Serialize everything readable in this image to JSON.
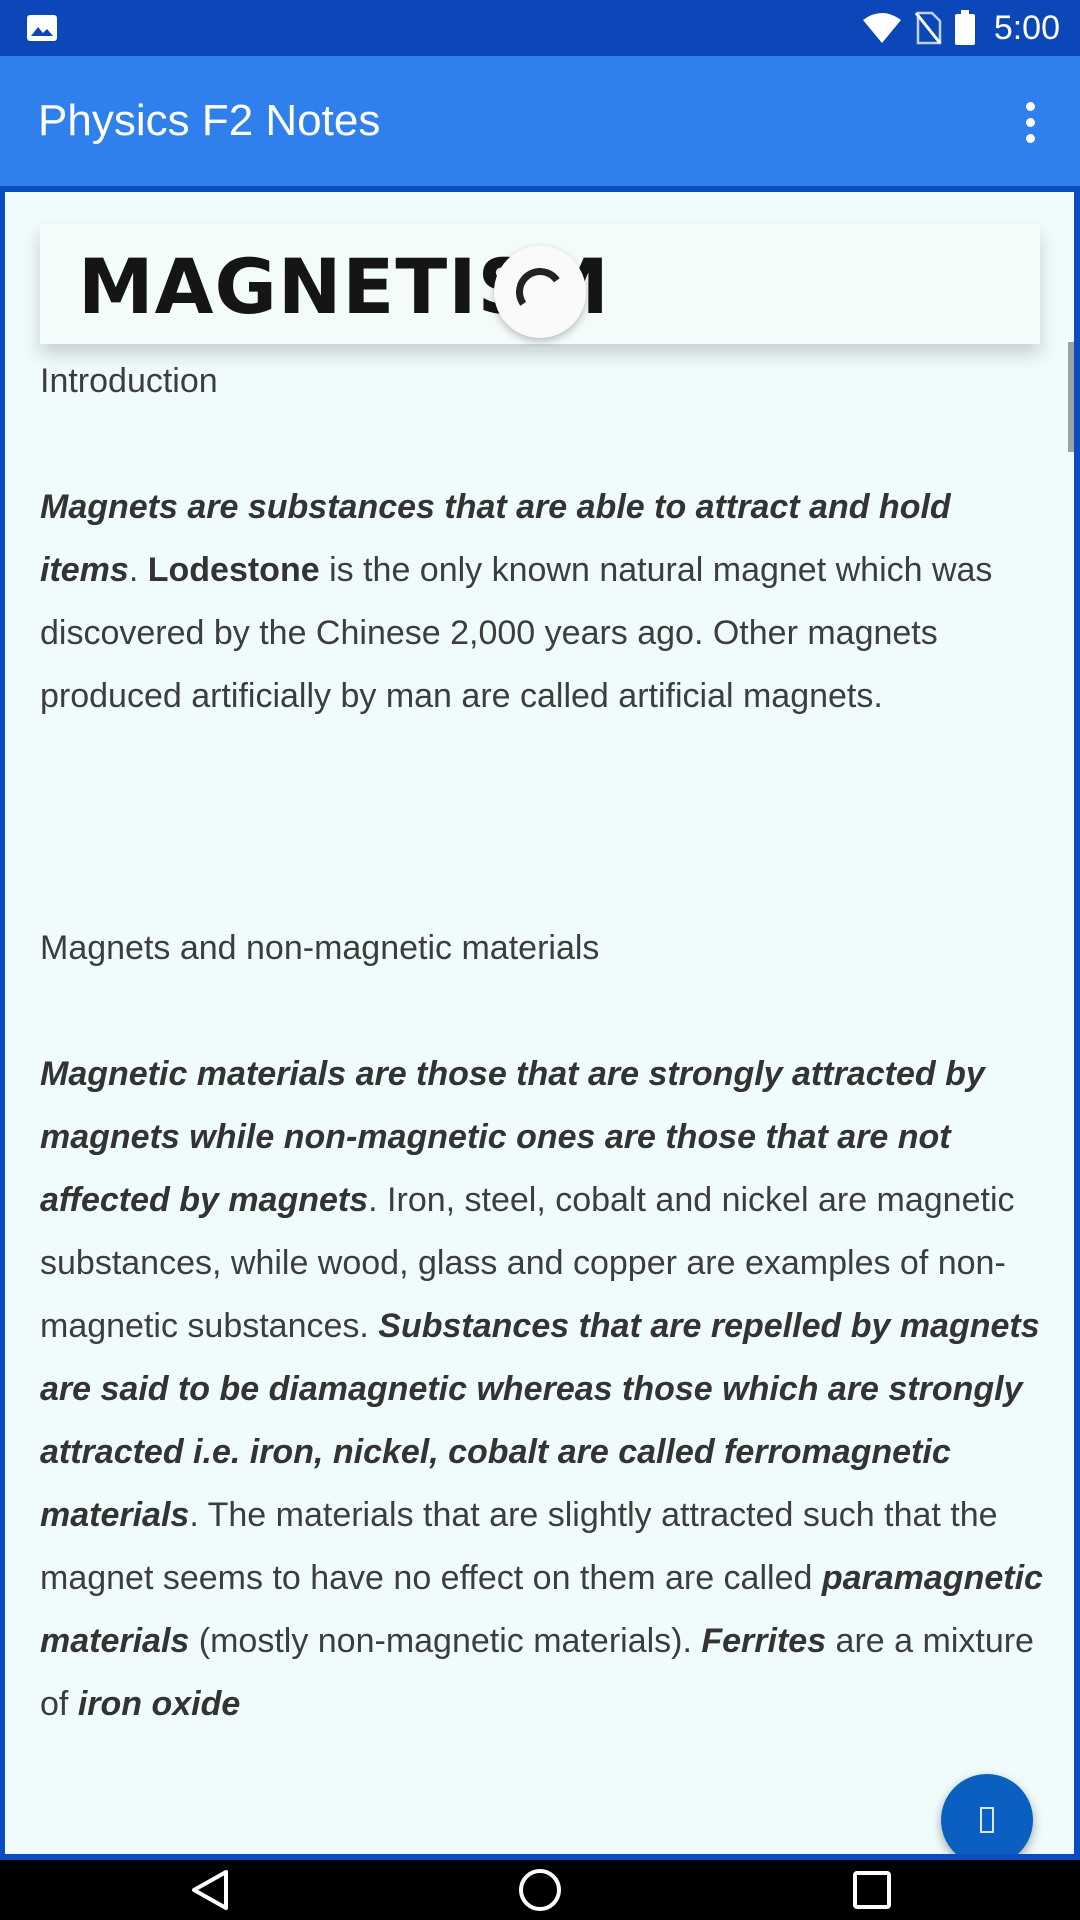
{
  "status_bar": {
    "time": "5:00",
    "icons": [
      "image-icon",
      "wifi-icon",
      "no-sim-icon",
      "battery-icon"
    ]
  },
  "app_bar": {
    "title": "Physics F2 Notes",
    "menu_icon": "overflow-menu-icon"
  },
  "article": {
    "title": "MAGNETISM",
    "sections": {
      "intro_heading": "Introduction",
      "intro_p1_bi": "Magnets are substances that are able to attract and hold items",
      "intro_p1_dot": ". ",
      "intro_p1_bold": "Lodestone",
      "intro_p1_rest": " is the only known natural magnet which was discovered by the Chinese 2,000 years ago. Other magnets produced artificially by man are called artificial magnets.",
      "materials_heading": "Magnets and non-magnetic materials",
      "m_p1_bi": "Magnetic materials are those that are strongly attracted by magnets while non-magnetic ones are those that are not affected by magnets",
      "m_p1_t1": ". Iron, steel, cobalt and nickel are magnetic substances, while wood, glass and copper are examples of non-magnetic substances. ",
      "m_p1_bi2": "Substances that are repelled by magnets are said to be diamagnetic whereas those which are strongly attracted i.e. iron, nickel, cobalt are called ferromagnetic materials",
      "m_p1_t2": ". The materials that are slightly attracted such that the magnet seems to have no effect on them are called ",
      "m_p1_bi3": "paramagnetic materials",
      "m_p1_t3": " (mostly non-magnetic materials). ",
      "m_p1_bi4": "Ferrites",
      "m_p1_t4": " are a mixture of ",
      "m_p1_bi5": "iron oxide"
    }
  },
  "loading_indicator": "loading-spinner",
  "fab": {
    "icon": "tofu-glyph-icon"
  },
  "nav_bar": {
    "icons": [
      "back-icon",
      "home-icon",
      "recents-icon"
    ]
  },
  "colors": {
    "status_bar": "#0b47b8",
    "app_bar": "#2f80ed",
    "content_bg": "#f0fcfc",
    "fab": "#0a5fc0"
  }
}
